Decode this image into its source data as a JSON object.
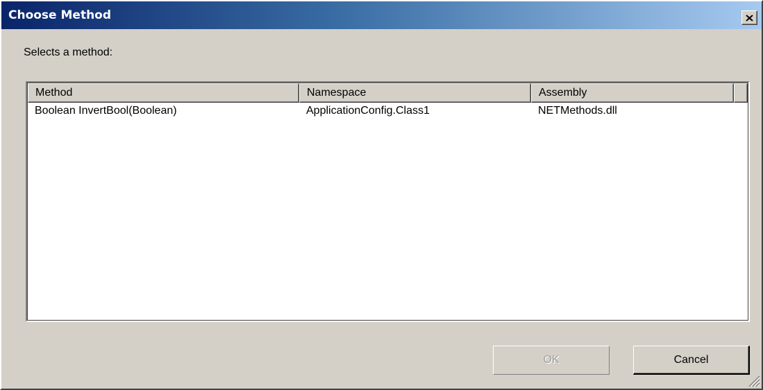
{
  "window": {
    "title": "Choose Method"
  },
  "titlebar": {
    "close_icon": "close-icon"
  },
  "prompt": "Selects a method:",
  "list": {
    "columns": [
      "Method",
      "Namespace",
      "Assembly"
    ],
    "rows": [
      {
        "method": "Boolean InvertBool(Boolean)",
        "namespace": "ApplicationConfig.Class1",
        "assembly": "NETMethods.dll"
      }
    ]
  },
  "buttons": {
    "ok_label": "OK",
    "ok_enabled": false,
    "cancel_label": "Cancel"
  },
  "colors": {
    "title_gradient_start": "#0a246a",
    "title_gradient_end": "#a6caf0",
    "dialog_background": "#d4d0c8",
    "list_background": "#ffffff",
    "disabled_text": "#a0a0a0"
  },
  "icons": {
    "close": "close-icon",
    "resize_grip": "resize-grip-icon"
  }
}
